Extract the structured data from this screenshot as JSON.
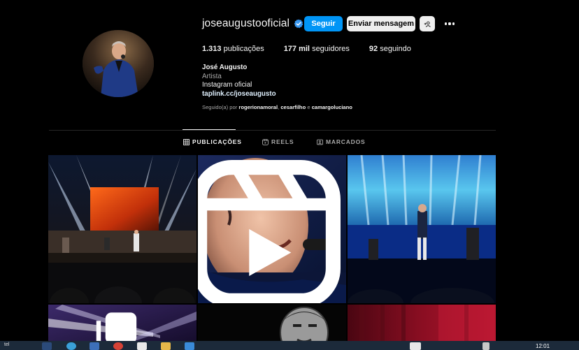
{
  "profile": {
    "username": "joseaugustooficial",
    "verified": true,
    "follow_label": "Seguir",
    "message_label": "Enviar mensagem",
    "add_user_icon": "person-plus-icon",
    "more_icon": "more-horizontal-icon",
    "stats": {
      "posts_value": "1.313",
      "posts_label": "publicações",
      "followers_value": "177 mil",
      "followers_label": "seguidores",
      "following_value": "92",
      "following_label": "seguindo"
    },
    "bio": {
      "name": "José Augusto",
      "category": "Artista",
      "line": "Instagram oficial",
      "link": "taplink.cc/joseaugusto"
    },
    "followed_by": {
      "prefix": "Seguido(a) por",
      "users": [
        "rogerionamoral",
        "cesarfilho",
        "camargoluciano"
      ],
      "separator": ",",
      "conjunction": "e"
    }
  },
  "tabs": [
    {
      "label": "PUBLICAÇÕES",
      "icon": "grid-icon",
      "active": true
    },
    {
      "label": "REELS",
      "icon": "reels-icon",
      "active": false
    },
    {
      "label": "MARCADOS",
      "icon": "tagged-icon",
      "active": false
    }
  ],
  "posts": [
    {
      "kind": "photo",
      "subject": "stage-wide"
    },
    {
      "kind": "reel",
      "subject": "singer-closeup"
    },
    {
      "kind": "photo",
      "subject": "singer-stage-blue"
    },
    {
      "kind": "carousel",
      "subject": "stage-lights"
    },
    {
      "kind": "photo",
      "subject": "portrait-bw"
    },
    {
      "kind": "photo",
      "subject": "red-curtain"
    }
  ],
  "taskbar": {
    "clock": "12:01",
    "left_text": "tel"
  },
  "colors": {
    "accent": "#0095f6",
    "background": "#000000",
    "secondary_text": "#a8a8a8"
  }
}
